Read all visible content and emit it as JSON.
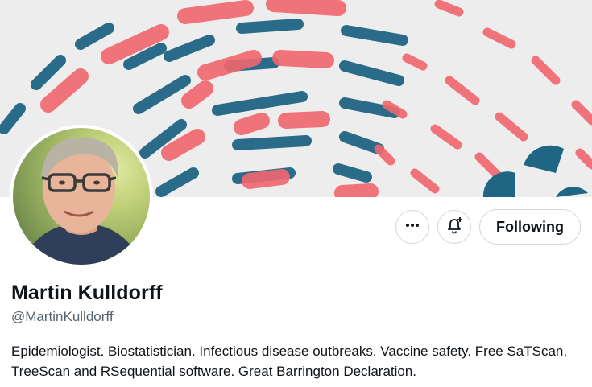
{
  "profile": {
    "name": "Martin Kulldorff",
    "handle": "@MartinKulldorff",
    "bio": "Epidemiologist. Biostatistician. Infectious disease outbreaks. Vaccine safety. Free SaTScan, TreeScan and RSequential software. Great Barrington Declaration."
  },
  "actions": {
    "more_icon": "more-horizontal-icon",
    "notify_icon": "bell-plus-icon",
    "follow_label": "Following"
  },
  "colors": {
    "banner_red": "#f2666e",
    "banner_blue": "#1f6584",
    "banner_bg": "#ededed",
    "text_primary": "#0f1419",
    "text_secondary": "#536471",
    "border": "#cfd9de"
  }
}
